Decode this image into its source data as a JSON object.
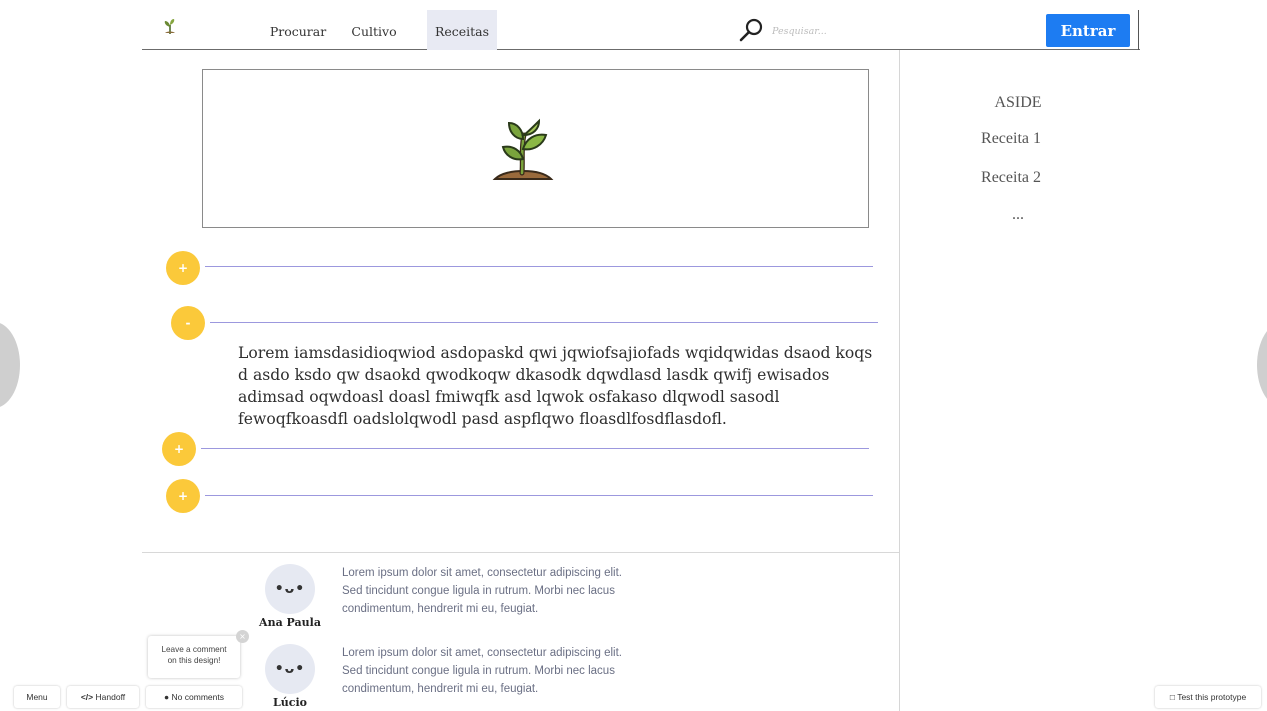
{
  "header": {
    "nav": [
      "Procurar",
      "Cultivo",
      "Receitas"
    ],
    "active_nav": "Receitas",
    "search_placeholder": "Pesquisar...",
    "login_label": "Entrar"
  },
  "aside": {
    "title": "ASIDE",
    "items": [
      "Receita 1",
      "Receita 2",
      "..."
    ]
  },
  "accordion": {
    "buttons": [
      "+",
      "-",
      "+",
      "+"
    ],
    "open_text": "Lorem iamsdasidioqwiod asdopaskd qwi jqwiofsajiofads wqidqwidas dsaod koqs d asdo ksdo qw dsaokd qwodkoqw dkasodk dqwdlasd lasdk qwifj ewisados adimsad oqwdoasl doasl fmiwqfk  asd lqwok osfakaso dlqwodl sasodl fewoqfkoasdfl oadslolqwodl pasd aspflqwo floasdlfosdflasdofl."
  },
  "comments": [
    {
      "avatar": "•ᴗ•",
      "name": "Ana Paula",
      "text": "Lorem ipsum dolor sit amet, consectetur adipiscing elit. Sed tincidunt congue ligula in rutrum. Morbi nec lacus condimentum, hendrerit mi eu, feugiat."
    },
    {
      "avatar": "•ᴗ•",
      "name": "Lúcio",
      "text": "Lorem ipsum dolor sit amet, consectetur adipiscing elit. Sed tincidunt congue ligula in rutrum. Morbi nec lacus condimentum, hendrerit mi eu, feugiat."
    }
  ],
  "toolbar": {
    "menu": "Menu",
    "handoff": "Handoff",
    "comments": "No comments",
    "test": "Test this prototype",
    "tooltip_line1": "Leave a comment",
    "tooltip_line2": "on this design!",
    "tooltip_close": "×"
  },
  "colors": {
    "accent": "#1d7cf2",
    "accordion": "#fbc93a",
    "line": "#9c98de",
    "active_tab": "#e8eaf3"
  }
}
